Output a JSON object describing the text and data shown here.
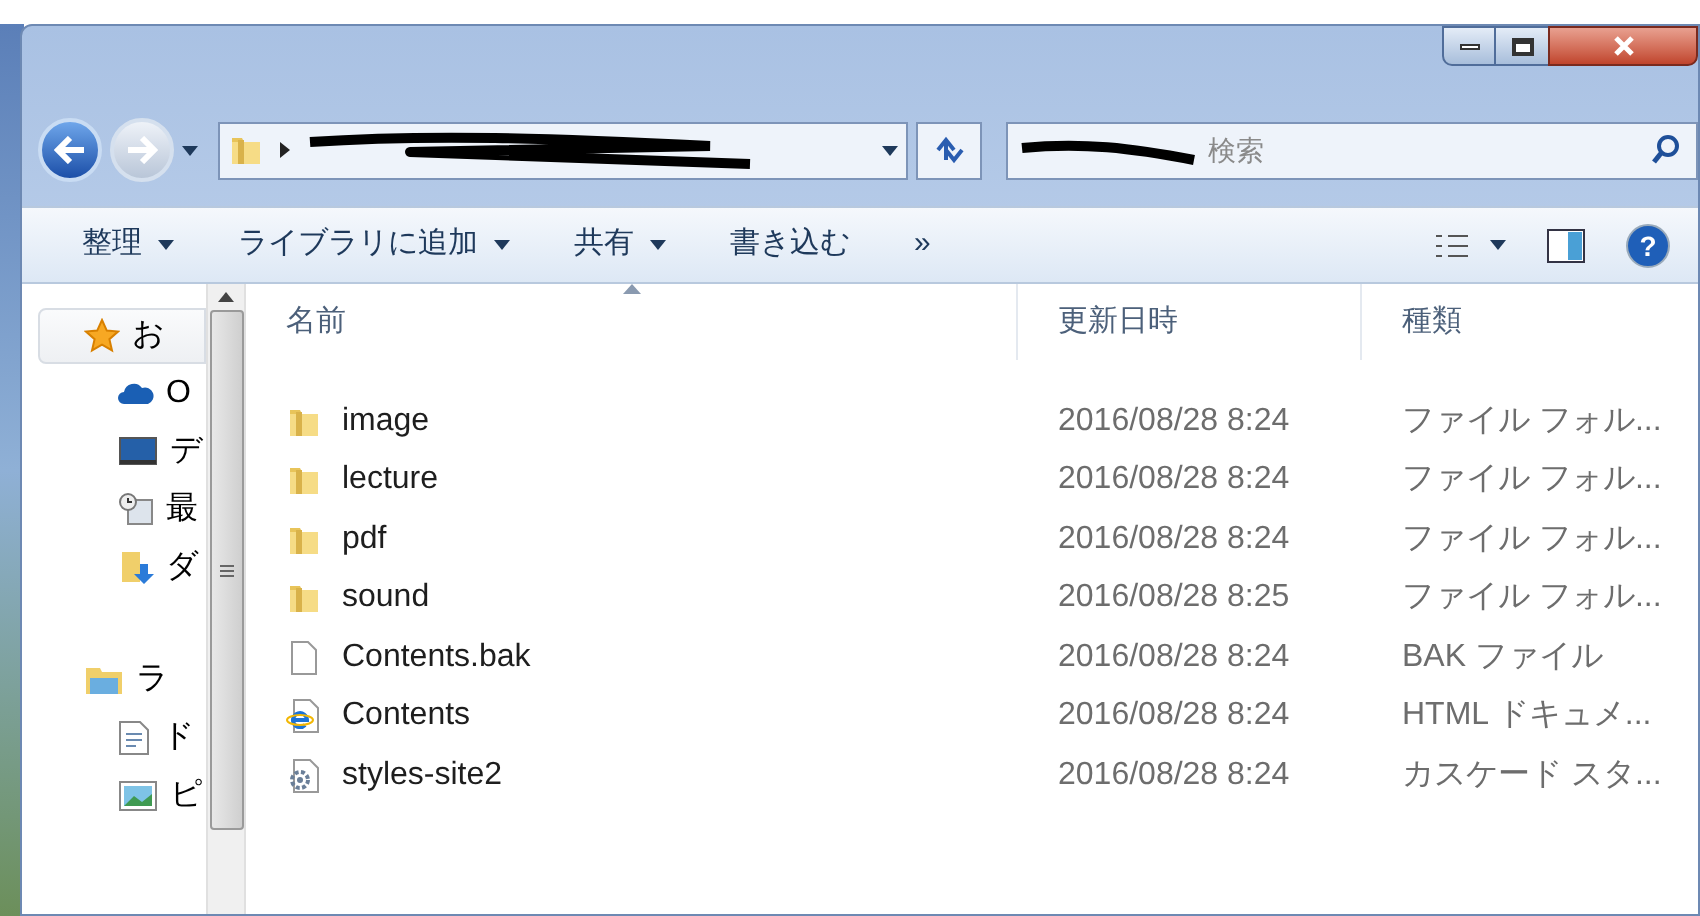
{
  "search": {
    "placeholder": "検索"
  },
  "toolbar": [
    {
      "label": "整理",
      "dropdown": true
    },
    {
      "label": "ライブラリに追加",
      "dropdown": true
    },
    {
      "label": "共有",
      "dropdown": true
    },
    {
      "label": "書き込む",
      "dropdown": false
    },
    {
      "label": "»",
      "dropdown": false
    }
  ],
  "sidebar": [
    {
      "label": "お",
      "kind": "star",
      "selected": true,
      "children": [
        {
          "label": "O",
          "kind": "cloud"
        },
        {
          "label": "デ",
          "kind": "desktop"
        },
        {
          "label": "最",
          "kind": "recent"
        },
        {
          "label": "ダ",
          "kind": "downloads"
        }
      ]
    },
    {
      "label": "ラ",
      "kind": "library",
      "selected": false,
      "children": [
        {
          "label": "ド",
          "kind": "document"
        },
        {
          "label": "ピ",
          "kind": "pictures"
        }
      ]
    }
  ],
  "help_button": {
    "label": "?"
  },
  "columns": [
    {
      "label": "名前",
      "sorted": true
    },
    {
      "label": "更新日時",
      "sorted": false
    },
    {
      "label": "種類",
      "sorted": false
    }
  ],
  "rows": [
    {
      "name": "image",
      "modified": "2016/08/28 8:24",
      "type": "ファイル フォル...",
      "kind": "folder"
    },
    {
      "name": "lecture",
      "modified": "2016/08/28 8:24",
      "type": "ファイル フォル...",
      "kind": "folder"
    },
    {
      "name": "pdf",
      "modified": "2016/08/28 8:24",
      "type": "ファイル フォル...",
      "kind": "folder"
    },
    {
      "name": "sound",
      "modified": "2016/08/28 8:25",
      "type": "ファイル フォル...",
      "kind": "folder"
    },
    {
      "name": "Contents.bak",
      "modified": "2016/08/28 8:24",
      "type": "BAK ファイル",
      "kind": "file"
    },
    {
      "name": "Contents",
      "modified": "2016/08/28 8:24",
      "type": "HTML ドキュメ...",
      "kind": "html"
    },
    {
      "name": "styles-site2",
      "modified": "2016/08/28 8:24",
      "type": "カスケード スタ...",
      "kind": "css"
    }
  ]
}
